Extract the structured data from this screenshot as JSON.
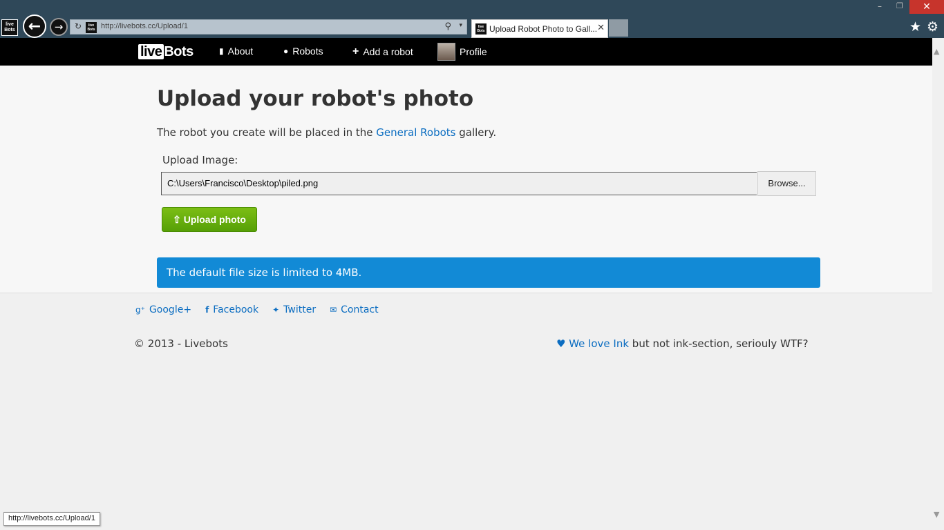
{
  "browser": {
    "url": "http://livebots.cc/Upload/1",
    "tab_title": "Upload Robot Photo to Gall...",
    "favicon_text": "live Bots",
    "status_url": "http://livebots.cc/Upload/1"
  },
  "nav": {
    "logo_live": "live",
    "logo_bots": "Bots",
    "items": [
      {
        "label": "About",
        "icon": "bookmark-icon"
      },
      {
        "label": "Robots",
        "icon": "globe-icon"
      },
      {
        "label": "Add a robot",
        "icon": "plus-icon"
      },
      {
        "label": "Profile",
        "icon": "avatar"
      }
    ]
  },
  "main": {
    "title": "Upload your robot's photo",
    "intro_prefix": "The robot you create will be placed in the ",
    "intro_link": "General Robots",
    "intro_suffix": " gallery.",
    "upload_label": "Upload Image:",
    "file_value": "C:\\Users\\Francisco\\Desktop\\piled.png",
    "browse_label": "Browse...",
    "upload_button": "Upload photo",
    "info_text": "The default file size is limited to 4MB."
  },
  "footer": {
    "links": [
      {
        "label": "Google+",
        "icon": "google-plus-icon"
      },
      {
        "label": "Facebook",
        "icon": "facebook-icon"
      },
      {
        "label": "Twitter",
        "icon": "twitter-icon"
      },
      {
        "label": "Contact",
        "icon": "envelope-icon"
      }
    ],
    "copyright": "2013 - Livebots",
    "love_link": "We love Ink",
    "love_suffix": " but not ink-section, seriouly WTF?"
  },
  "colors": {
    "accent": "#0b6dc1",
    "info_bg": "#128ad6",
    "upload_green": "#6cb20f",
    "navbar": "#000000"
  }
}
